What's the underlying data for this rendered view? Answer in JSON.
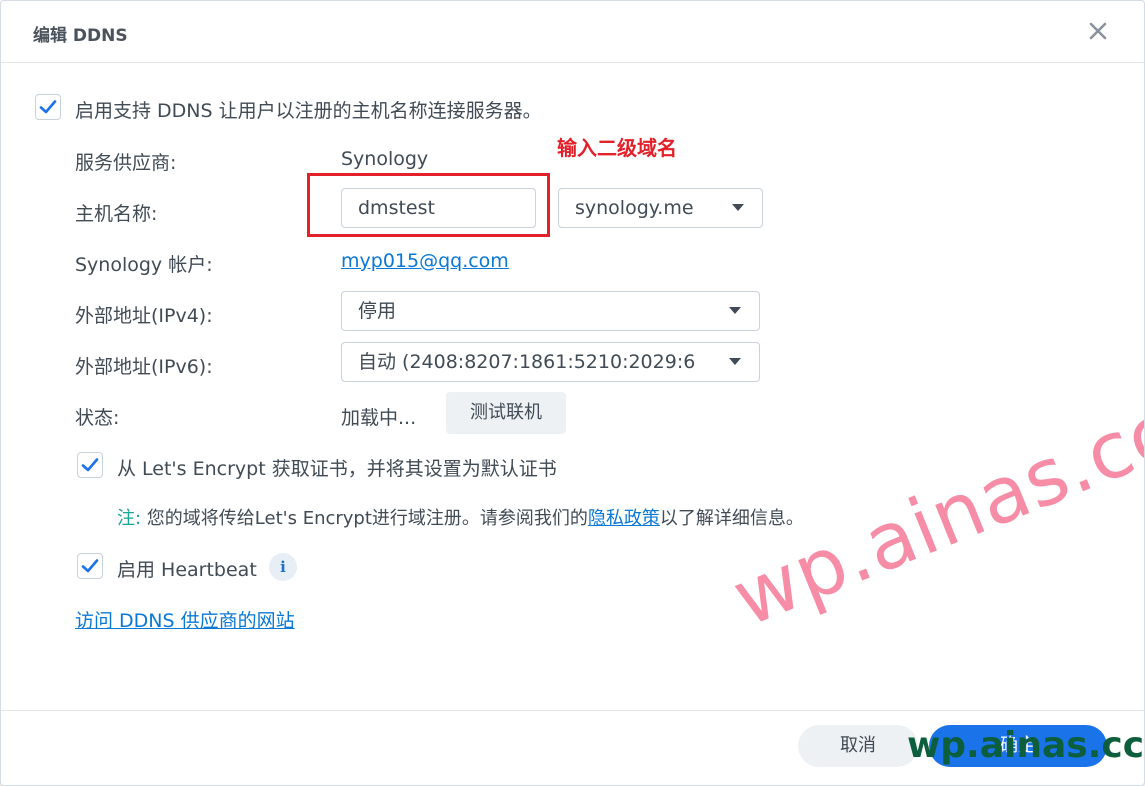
{
  "dialog": {
    "title": "编辑 DDNS",
    "enable_ddns": {
      "checked": true,
      "label": "启用支持 DDNS 让用户以注册的主机名称连接服务器。"
    },
    "fields": {
      "provider": {
        "label": "服务供应商:",
        "value": "Synology"
      },
      "hostname": {
        "label": "主机名称:",
        "value": "dmstest",
        "domain": "synology.me"
      },
      "account": {
        "label": "Synology 帐户:",
        "value": "myp015@qq.com"
      },
      "ipv4": {
        "label": "外部地址(IPv4):",
        "value": "停用"
      },
      "ipv6": {
        "label": "外部地址(IPv6):",
        "value": "自动 (2408:8207:1861:5210:2029:6"
      },
      "status": {
        "label": "状态:",
        "value": "加载中...",
        "test_button": "测试联机"
      }
    },
    "lets_encrypt": {
      "checked": true,
      "label": "从 Let's Encrypt 获取证书，并将其设置为默认证书"
    },
    "note": {
      "prefix": "注:",
      "text_before": " 您的域将传给Let's Encrypt进行域注册。请参阅我们的",
      "link": "隐私政策",
      "text_after": "以了解详细信息。"
    },
    "heartbeat": {
      "checked": true,
      "label": "启用 Heartbeat",
      "info_icon": "i"
    },
    "visit_link": "访问 DDNS 供应商的网站",
    "footer": {
      "cancel": "取消",
      "confirm": "确定"
    }
  },
  "annotations": {
    "callout": "输入二级域名",
    "watermark_large": "wp.ainas.cc",
    "watermark_small": "wp.ainas.cc"
  },
  "icons": {
    "close": "close-icon",
    "check": "checkmark-icon",
    "caret": "caret-down-icon",
    "info": "info-icon"
  },
  "colors": {
    "accent": "#1a73e8",
    "link": "#0a78d6",
    "note_prefix": "#17a398",
    "annotation_red": "#e3212b",
    "watermark_pink": "#f47896",
    "watermark_green": "#0d5e3c"
  }
}
